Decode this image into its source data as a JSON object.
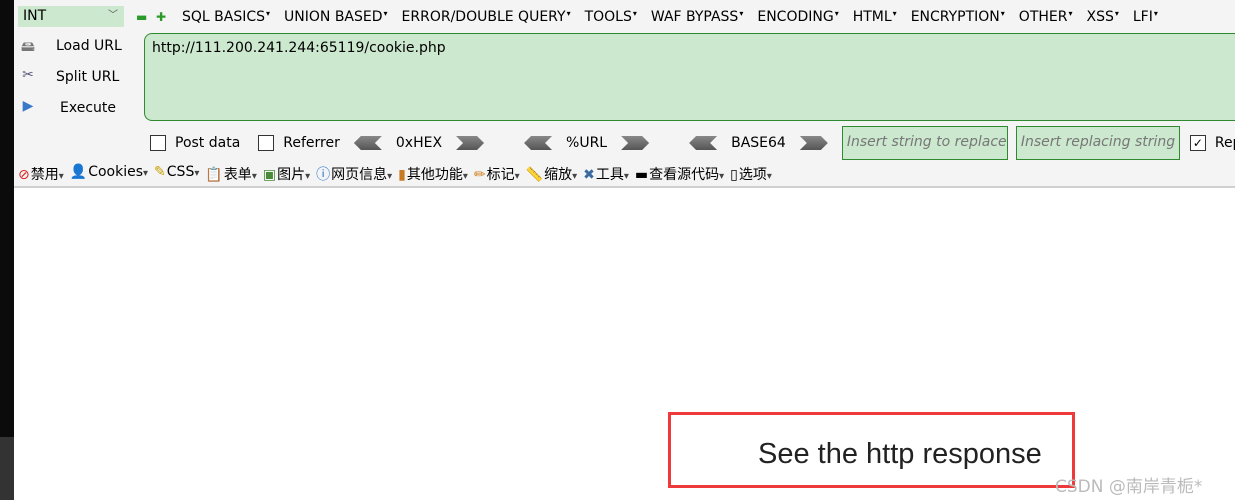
{
  "selector": {
    "value": "INT"
  },
  "menu": [
    "SQL BASICS",
    "UNION BASED",
    "ERROR/DOUBLE QUERY",
    "TOOLS",
    "WAF BYPASS",
    "ENCODING",
    "HTML",
    "ENCRYPTION",
    "OTHER",
    "XSS",
    "LFI"
  ],
  "actions": {
    "load": "Load URL",
    "split": "Split URL",
    "execute": "Execute"
  },
  "url": "http://111.200.241.244:65119/cookie.php",
  "options": {
    "post": "Post data",
    "referrer": "Referrer",
    "hex": "0xHEX",
    "url": "%URL",
    "b64": "BASE64",
    "find_ph": "Insert string to replace",
    "replace_ph": "Insert replacing string",
    "replace_all": "Replace All"
  },
  "devbar": [
    "禁用",
    "Cookies",
    "CSS",
    "表单",
    "图片",
    "网页信息",
    "其他功能",
    "标记",
    "缩放",
    "工具",
    "查看源代码",
    "选项"
  ],
  "page": {
    "text": "See the http response"
  },
  "watermark": "CSDN @南岸青栀*",
  "colors": {
    "field_bg": "#cce8cf",
    "highlight": "#ee3a3a"
  }
}
